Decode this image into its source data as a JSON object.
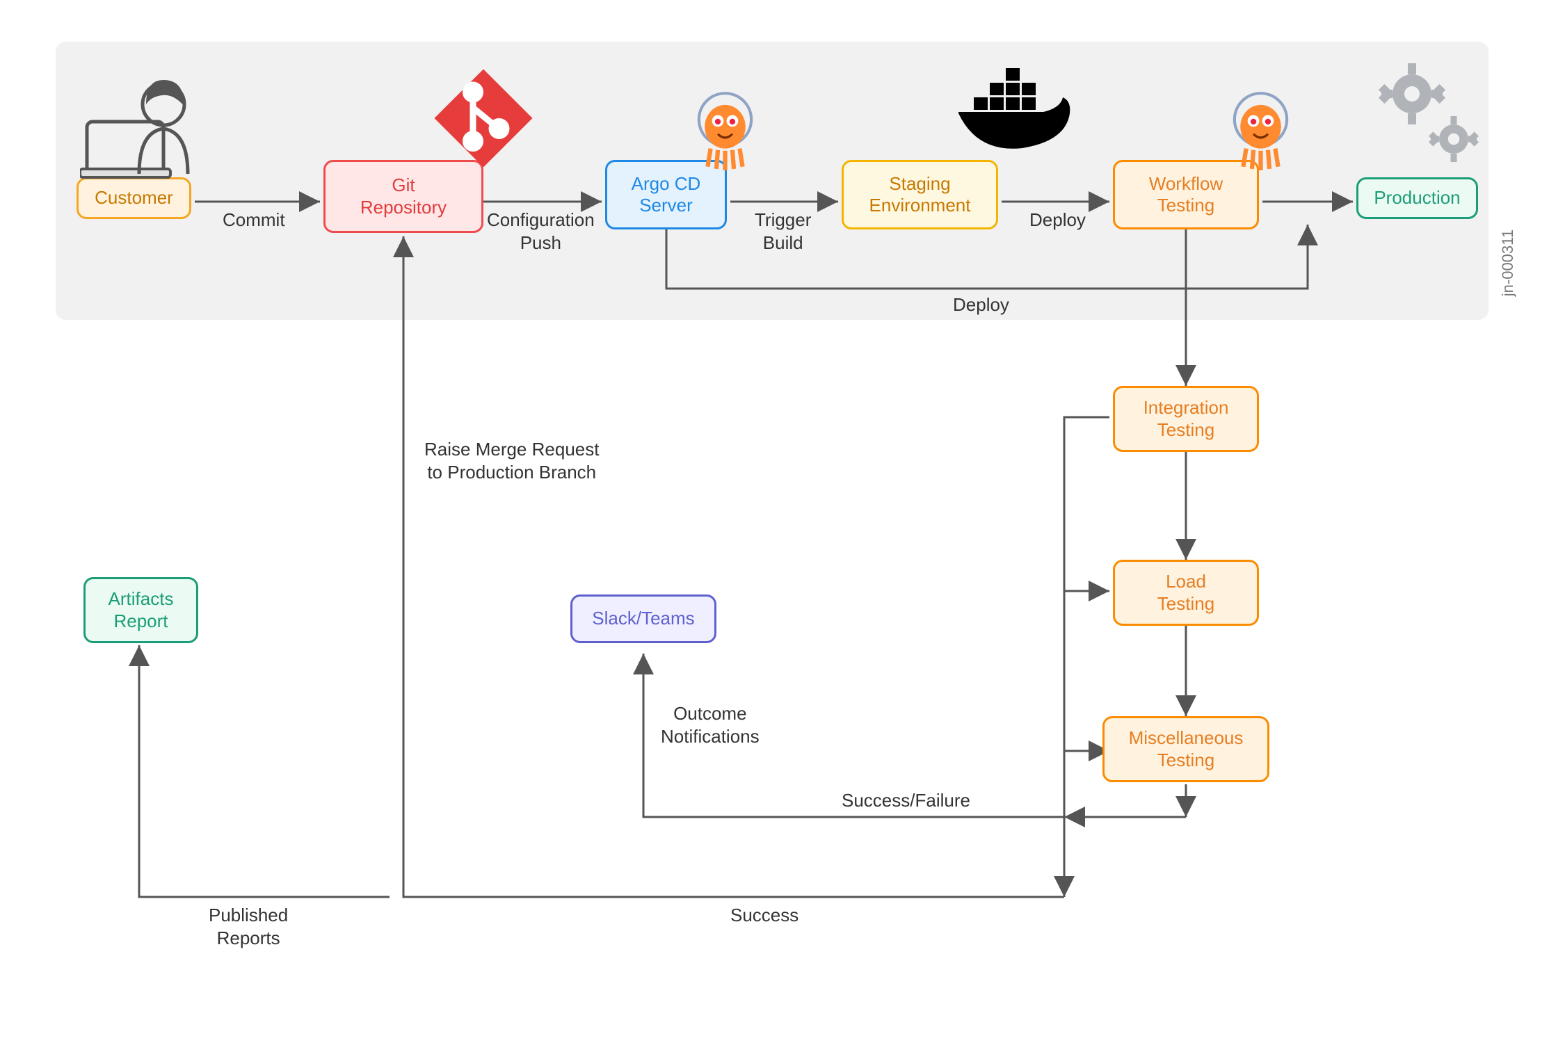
{
  "meta": {
    "figure_id": "jn-000311"
  },
  "nodes": {
    "customer": "Customer",
    "git": "Git\nRepository",
    "argocd": "Argo CD\nServer",
    "staging": "Staging\nEnvironment",
    "workflow": "Workflow\nTesting",
    "production": "Production",
    "integration": "Integration\nTesting",
    "load": "Load\nTesting",
    "misc": "Miscellaneous\nTesting",
    "artifacts": "Artifacts\nReport",
    "slack": "Slack/Teams"
  },
  "edges": {
    "commit": "Commit",
    "config_push": "Configuration\nPush",
    "trigger_build": "Trigger\nBuild",
    "deploy1": "Deploy",
    "deploy2": "Deploy",
    "raise_merge": "Raise Merge Request\nto Production Branch",
    "outcome": "Outcome\nNotifications",
    "success_failure": "Success/Failure",
    "success": "Success",
    "published": "Published\nReports"
  }
}
